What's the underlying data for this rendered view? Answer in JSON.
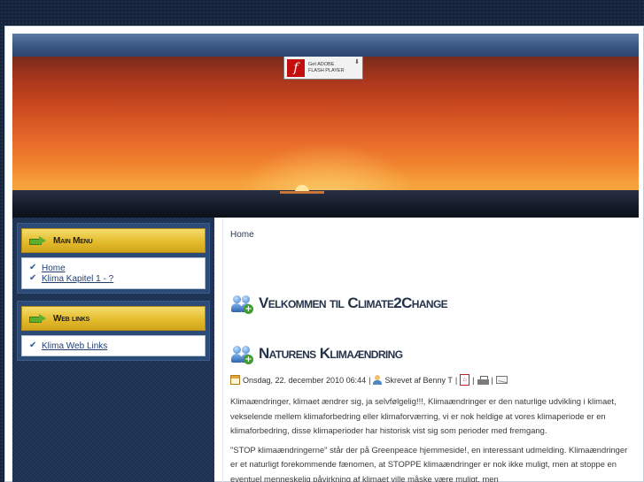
{
  "flash_badge": {
    "line1": "Get ADOBE",
    "line2": "FLASH PLAYER",
    "icon": "flash-icon"
  },
  "sidebar": {
    "main_menu": {
      "title": "Main Menu",
      "items": [
        {
          "label": "Home"
        },
        {
          "label": "Klima Kapitel 1 - ?"
        }
      ]
    },
    "web_links": {
      "title": "Web links",
      "items": [
        {
          "label": "Klima Web Links"
        }
      ]
    }
  },
  "content": {
    "breadcrumb": "Home",
    "page_title": "Velkommen til Climate2Change",
    "article": {
      "title": "Naturens Klimaændring",
      "date": "Onsdag, 22. december 2010 06:44",
      "author": "Skrevet af Benny T",
      "paragraphs": [
        "Klimaændringer, klimaet ændrer sig, ja selvfølgelig!!!, Klimaændringer er den naturlige udvikling i klimaet, vekselende mellem klimaforbedring eller klimaforværring, vi er nok heldige at vores klimaperiode er en klimaforbedring, disse klimaperioder har historisk vist sig som perioder med fremgang.",
        "\"STOP klimaændringerne\" står der på Greenpeace hjemmeside!, en interessant udmelding. Klimaændringer er et naturligt forekommende fænomen, at STOPPE klimaændringer er nok ikke muligt, men at stoppe en eventuel menneskelig påvirkning af klimaet ville måske være muligt, men"
      ]
    }
  }
}
